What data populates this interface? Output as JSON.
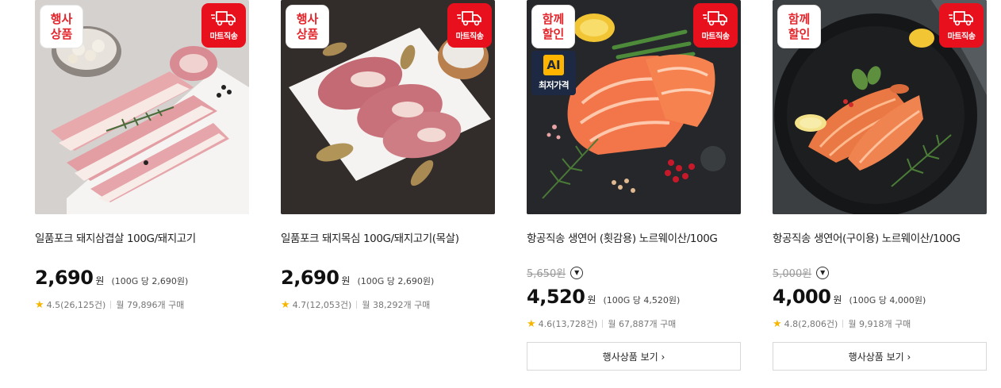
{
  "badges": {
    "event_1": "행사",
    "event_2": "상품",
    "together_1": "함께",
    "together_2": "할인",
    "mart_shipping": "마트직송",
    "ai": "AI",
    "ai_label": "최저가격"
  },
  "products": [
    {
      "title": "일품포크 돼지삼겹살 100G/돼지고기",
      "price": "2,690",
      "won": "원",
      "unit_price": "(100G 당 2,690원)",
      "rating": "4.5(26,125건)",
      "monthly": "월 79,896개 구매"
    },
    {
      "title": "일품포크 돼지목심 100G/돼지고기(목살)",
      "price": "2,690",
      "won": "원",
      "unit_price": "(100G 당 2,690원)",
      "rating": "4.7(12,053건)",
      "monthly": "월 38,292개 구매"
    },
    {
      "title": "항공직송 생연어 (횟감용) 노르웨이산/100G",
      "original_price": "5,650원",
      "price": "4,520",
      "won": "원",
      "unit_price": "(100G 당 4,520원)",
      "rating": "4.6(13,728건)",
      "monthly": "월 67,887개 구매",
      "promo_button": "행사상품 보기 ›"
    },
    {
      "title": "항공직송 생연어(구이용) 노르웨이산/100G",
      "original_price": "5,000원",
      "price": "4,000",
      "won": "원",
      "unit_price": "(100G 당 4,000원)",
      "rating": "4.8(2,806건)",
      "monthly": "월 9,918개 구매",
      "promo_button": "행사상품 보기 ›"
    }
  ],
  "colors": {
    "accent_red": "#e8101c",
    "badge_text_red": "#e3252c",
    "star": "#f7b500"
  }
}
